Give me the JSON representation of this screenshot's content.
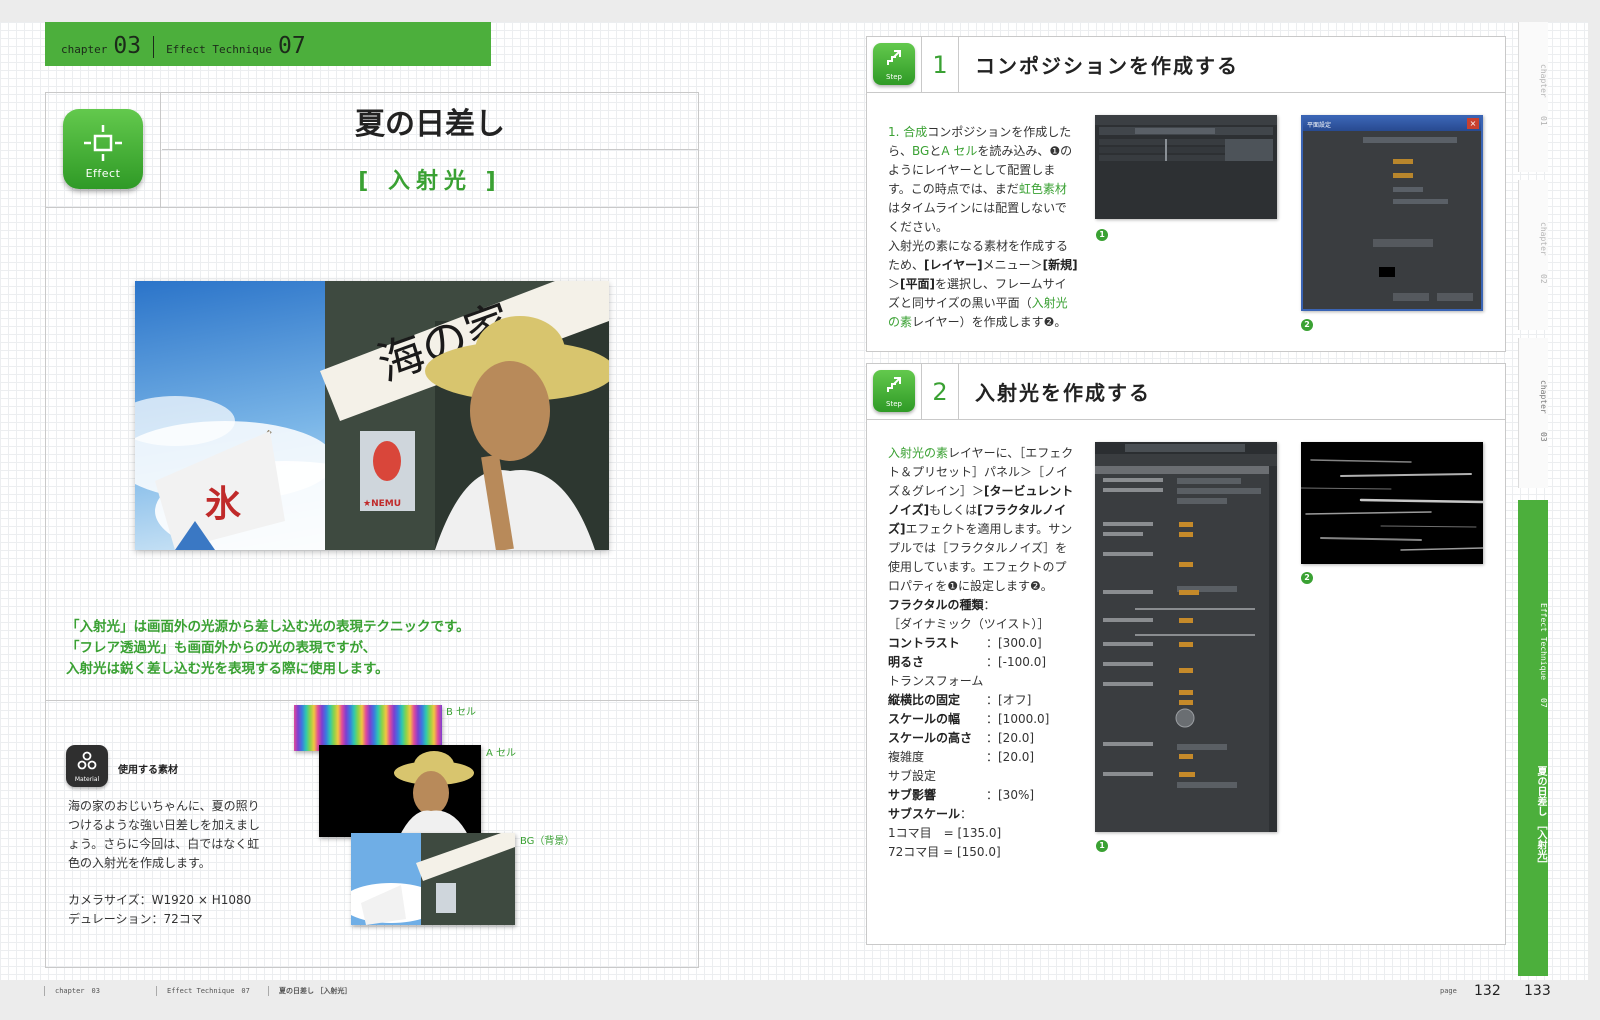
{
  "header": {
    "chapter_label": "chapter",
    "chapter_num": "03",
    "technique_label": "Effect Technique",
    "technique_num": "07"
  },
  "title": {
    "icon_label": "Effect",
    "main": "夏の日差し",
    "sub": "[ 入射光 ]"
  },
  "intro_lines": [
    "「入射光」は画面外の光源から差し込む光の表現テクニックです。",
    "「フレア透過光」も画面外からの光の表現ですが、",
    "入射光は鋭く差し込む光を表現する際に使用します。"
  ],
  "material": {
    "icon_label": "Material",
    "label": "使用する素材",
    "description": "海の家のおじいちゃんに、夏の照りつけるような強い日差しを加えましょう。さらに今回は、白ではなく虹色の入射光を作成します。",
    "camera_size": "カメラサイズ：W1920 × H1080",
    "duration": "デュレーション：72コマ",
    "cel_b": "B セル",
    "cel_a": "A セル",
    "cel_bg": "BG（背景）"
  },
  "hero": {
    "sign_text": "海の家",
    "flag_text": "氷",
    "poster_text": "★NEMU"
  },
  "step1": {
    "icon_label": "Step",
    "num": "1",
    "title": "コンポジションを作成する",
    "p1": [
      {
        "t": "1. 合成",
        "c": "g"
      },
      {
        "t": "コンポジションを作成したら、",
        "c": ""
      },
      {
        "t": "BG",
        "c": "g"
      },
      {
        "t": "と",
        "c": ""
      },
      {
        "t": "A セル",
        "c": "g"
      },
      {
        "t": "を読み込み、❶のようにレイヤーとして配置します。この時点では、まだ",
        "c": ""
      },
      {
        "t": "虹色素材",
        "c": "g"
      },
      {
        "t": "はタイムラインには配置しないでください。",
        "c": ""
      }
    ],
    "p2": [
      {
        "t": "入射光の素になる素材を作成するため、",
        "c": ""
      },
      {
        "t": "[レイヤー]",
        "c": "b"
      },
      {
        "t": "メニュー＞",
        "c": ""
      },
      {
        "t": "[新規]",
        "c": "b"
      },
      {
        "t": "＞",
        "c": ""
      },
      {
        "t": "[平面]",
        "c": "b"
      },
      {
        "t": "を選択し、フレームサイズと同サイズの黒い平面（",
        "c": ""
      },
      {
        "t": "入射光の素",
        "c": "g"
      },
      {
        "t": "レイヤー）を作成します❷。",
        "c": ""
      }
    ],
    "badge1": "1",
    "badge2": "2",
    "dialog_title": "平面設定",
    "dialog_close": "×"
  },
  "step2": {
    "icon_label": "Step",
    "num": "2",
    "title": "入射光を作成する",
    "p1": [
      {
        "t": "入射光の素",
        "c": "g"
      },
      {
        "t": "レイヤーに、［エフェクト＆プリセット］パネル＞［ノイズ＆グレイン］＞",
        "c": ""
      },
      {
        "t": "[タービュレントノイズ]",
        "c": "b"
      },
      {
        "t": "もしくは",
        "c": ""
      },
      {
        "t": "[フラクタルノイズ]",
        "c": "b"
      },
      {
        "t": "エフェクトを適用します。サンプルでは［フラクタルノイズ］を使用しています。エフェクトのプロパティを❶に設定します❷。",
        "c": ""
      }
    ],
    "props": [
      {
        "k": "フラクタルの種類",
        "v": "：",
        "bold": true,
        "full": true
      },
      {
        "k": "［ダイナミック（ツイスト）］",
        "v": "",
        "bold": false,
        "full": true
      },
      {
        "k": "コントラスト",
        "v": "：[300.0]",
        "bold": true,
        "full": false
      },
      {
        "k": "明るさ",
        "v": "：[-100.0]",
        "bold": true,
        "full": false
      },
      {
        "k": "トランスフォーム",
        "v": "",
        "bold": false,
        "full": true
      },
      {
        "k": "縦横比の固定",
        "v": "：[オフ]",
        "bold": true,
        "full": false
      },
      {
        "k": "スケールの幅",
        "v": "：[1000.0]",
        "bold": true,
        "full": false
      },
      {
        "k": "スケールの高さ",
        "v": "：[20.0]",
        "bold": true,
        "full": false
      },
      {
        "k": "複雑度",
        "v": "：[20.0]",
        "bold": false,
        "full": false
      },
      {
        "k": "サブ設定",
        "v": "",
        "bold": false,
        "full": true
      },
      {
        "k": "サブ影響",
        "v": "：[30%]",
        "bold": true,
        "full": false
      },
      {
        "k": "サブスケール",
        "v": "：",
        "bold": true,
        "full": true
      },
      {
        "k": "1コマ目　= [135.0]",
        "v": "",
        "bold": false,
        "full": true
      },
      {
        "k": "72コマ目 = [150.0]",
        "v": "",
        "bold": false,
        "full": true
      }
    ],
    "badge1": "1",
    "badge2": "2"
  },
  "side_tabs": [
    {
      "label": "chapter",
      "num": "01"
    },
    {
      "label": "chapter",
      "num": "02"
    },
    {
      "label": "chapter",
      "num": "03"
    },
    {
      "label": "Effect Technique",
      "num": "07",
      "title": "夏の日差し ［入射光］"
    }
  ],
  "footer": {
    "chapter": "chapter　03",
    "technique": "Effect Technique　07",
    "title": "夏の日差し ［入射光］",
    "page_label": "page",
    "page_left": "132",
    "page_right": "133"
  },
  "colors": {
    "accent": "#4caf3c",
    "accent_text": "#3aa133"
  }
}
